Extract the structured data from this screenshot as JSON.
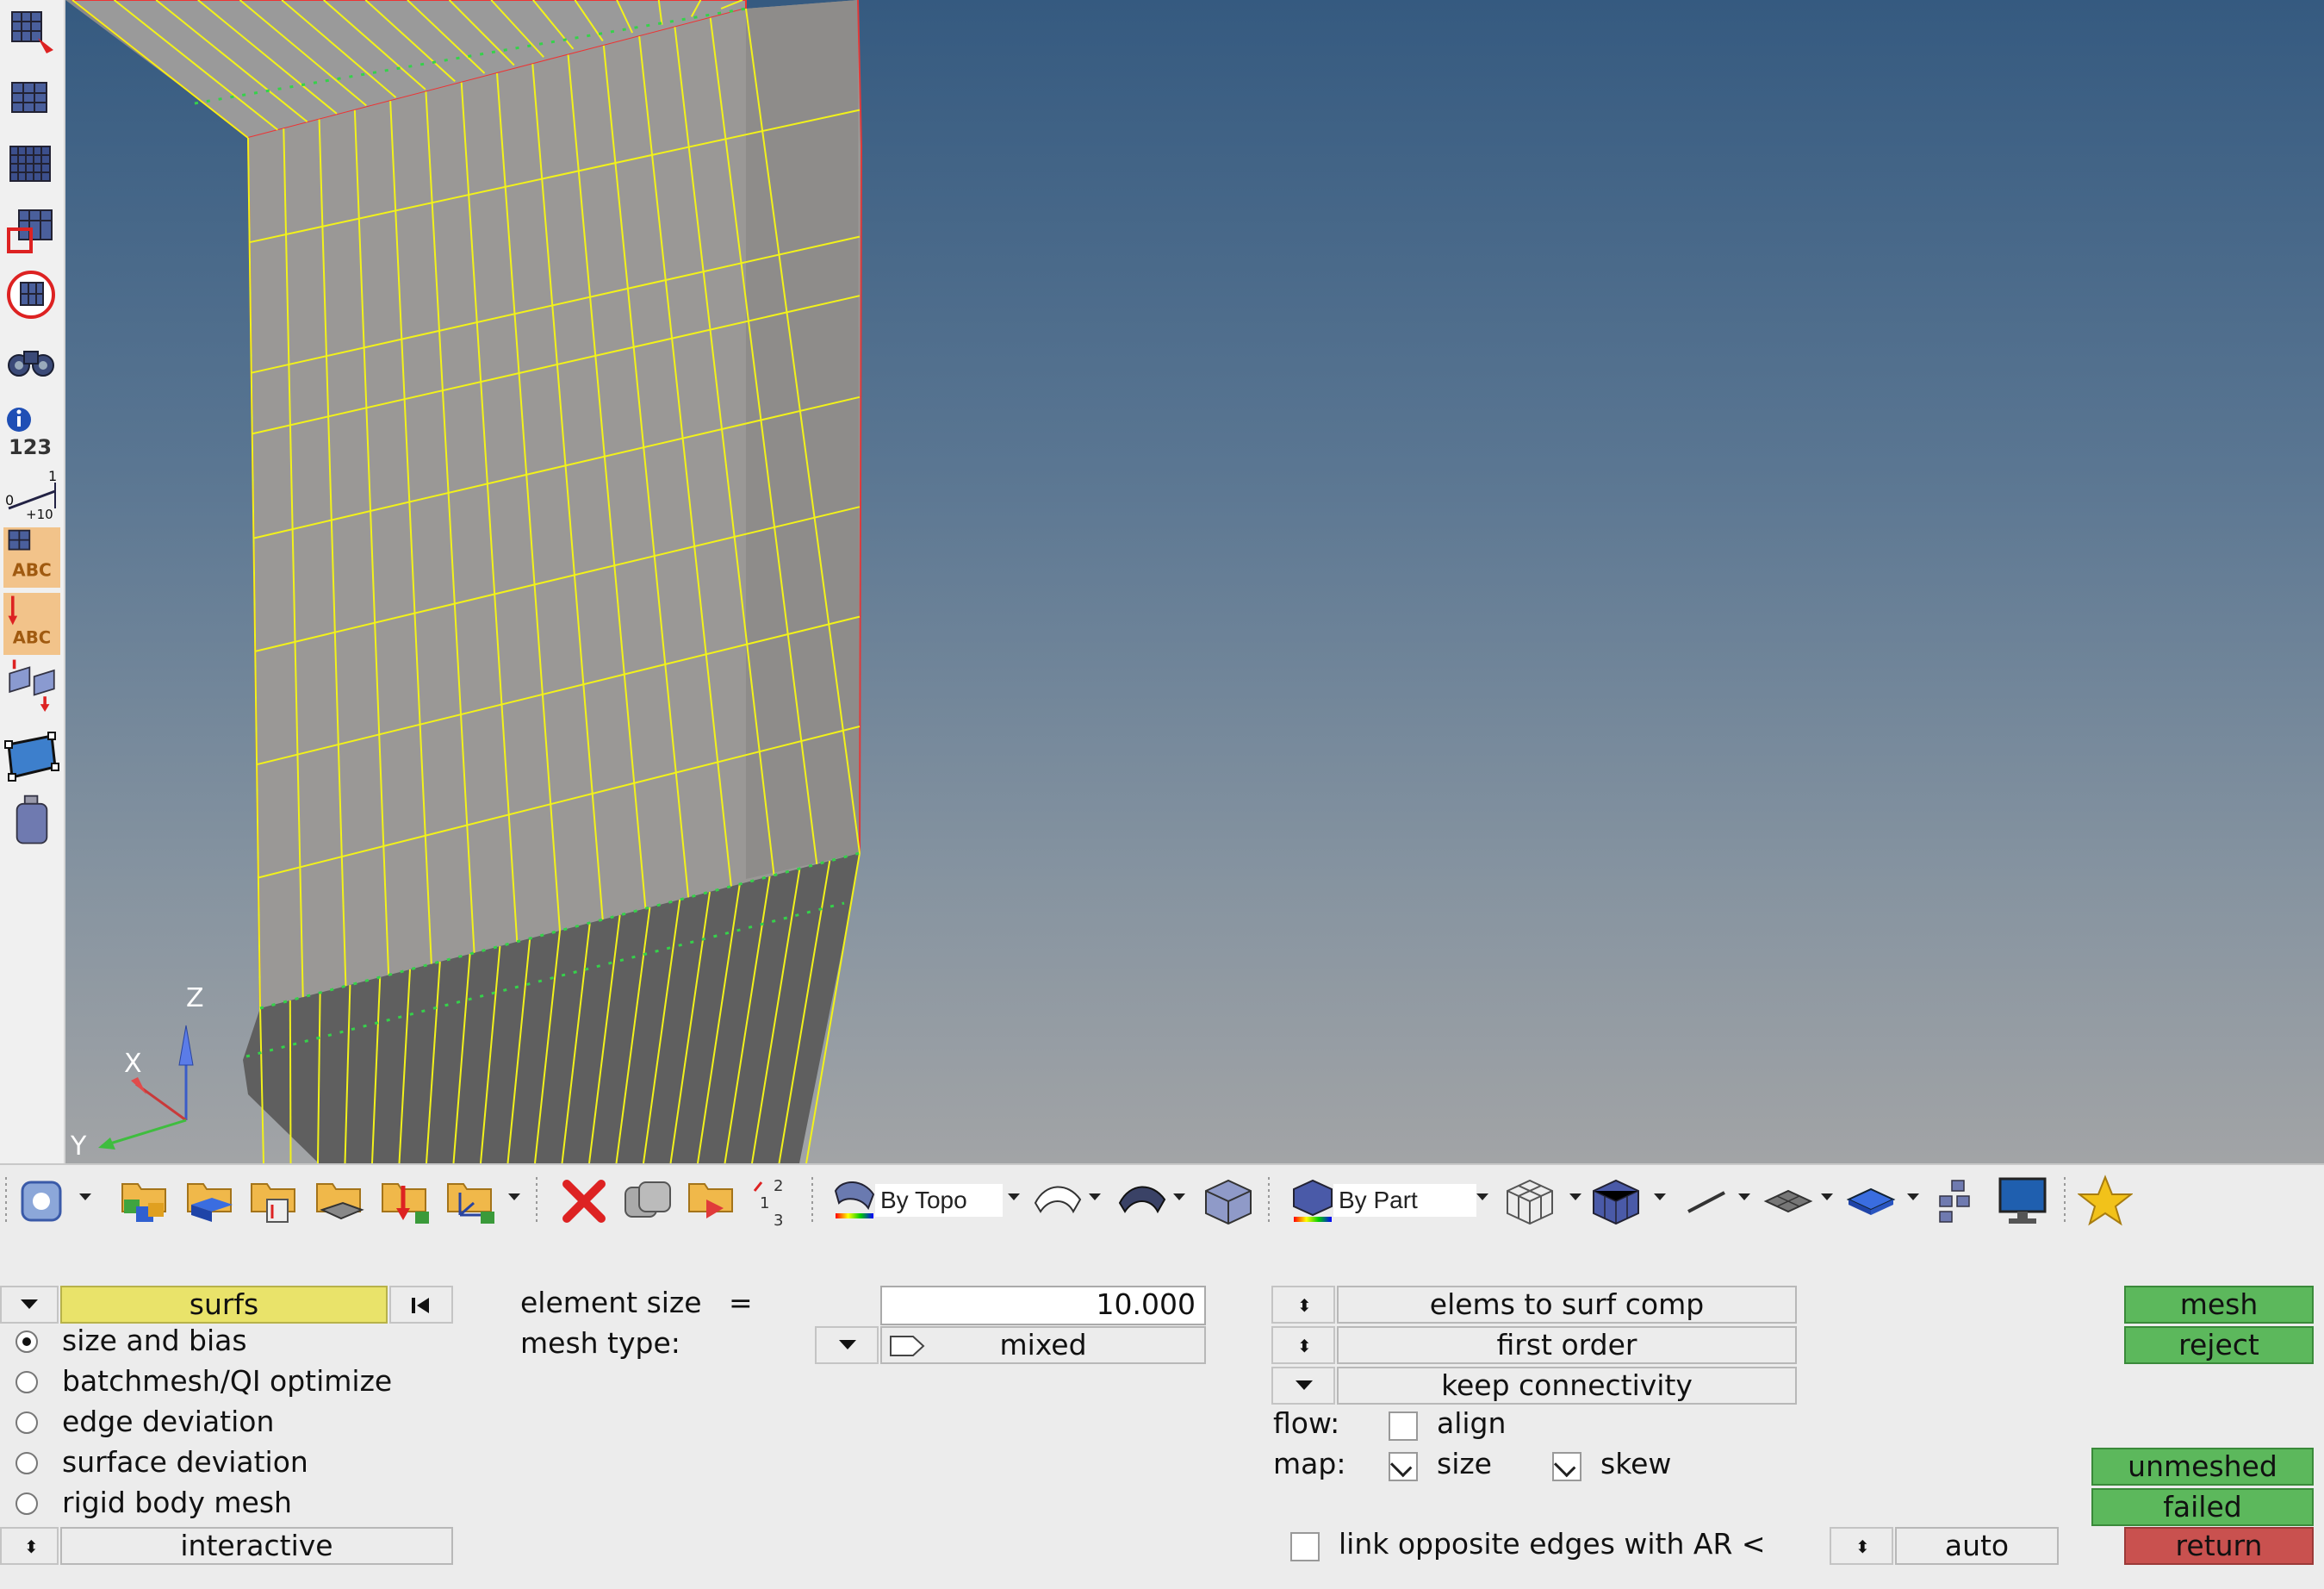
{
  "viewport": {
    "axes": {
      "z": "Z",
      "x": "X",
      "y": "Y"
    }
  },
  "left_toolbar": {
    "icons": [
      "mesh-reject-icon",
      "mesh-grid-icon",
      "mesh-dense-icon",
      "mesh-select-icon",
      "mesh-circle-icon",
      "binoculars-icon",
      "info-icon",
      "numbers-icon",
      "scale-icon",
      "label-abc-icon",
      "label-abc-load-icon",
      "transfer-icon",
      "surface-icon",
      "mass-icon"
    ],
    "numbers_text": "123",
    "scale_text": {
      "zero": "0",
      "one": "1",
      "ten": "+10"
    },
    "abc_text": "ABC"
  },
  "toolbar": {
    "topo_combo": "By Topo",
    "part_combo": "By Part"
  },
  "panel": {
    "entity_selector": "surfs",
    "modes": [
      {
        "label": "size and bias",
        "checked": true
      },
      {
        "label": "batchmesh/QI optimize",
        "checked": false
      },
      {
        "label": "edge deviation",
        "checked": false
      },
      {
        "label": "surface deviation",
        "checked": false
      },
      {
        "label": "rigid body mesh",
        "checked": false
      }
    ],
    "interactive": "interactive",
    "element_size_label": "element size",
    "equals": "=",
    "element_size_value": "10.000",
    "mesh_type_label": "mesh type:",
    "mesh_type_value": "mixed",
    "elems_to_surf_comp": "elems to surf comp",
    "first_order": "first order",
    "keep_connectivity": "keep connectivity",
    "flow_label": "flow:",
    "align_label": "align",
    "align_checked": false,
    "map_label": "map:",
    "size_label": "size",
    "size_checked": true,
    "skew_label": "skew",
    "skew_checked": true,
    "link_label": "link opposite edges with AR <",
    "link_checked": false,
    "auto_label": "auto",
    "mesh_btn": "mesh",
    "reject_btn": "reject",
    "unmeshed_btn": "unmeshed",
    "failed_btn": "failed",
    "return_btn": "return"
  },
  "colors": {
    "green_button": "#5cb85c",
    "red_button": "#c9514f",
    "selector_yellow": "#e9e36a",
    "mesh_line": "#f2f21a",
    "viewport_top": "#355a80",
    "viewport_bottom": "#a2a4a6"
  }
}
